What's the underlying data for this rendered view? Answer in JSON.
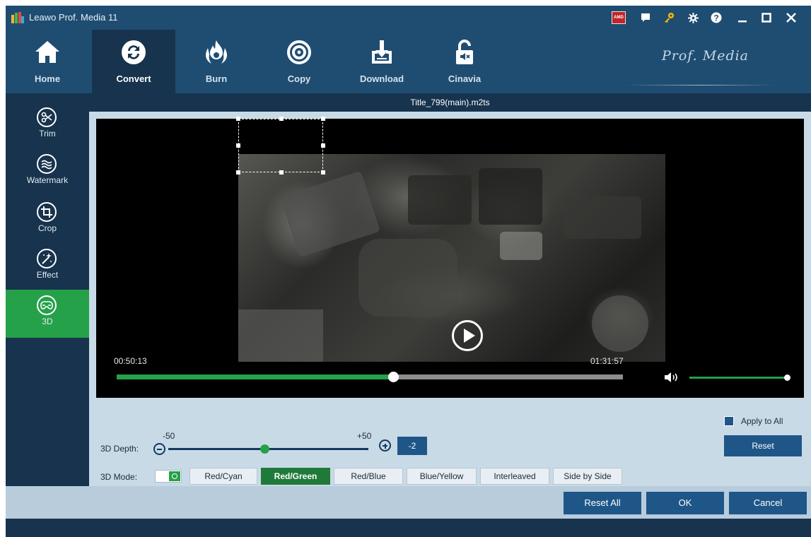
{
  "app": {
    "title": "Leawo Prof. Media 11",
    "brand": "Prof. Media"
  },
  "toolbar": {
    "items": [
      {
        "label": "Home",
        "icon": "home-icon",
        "active": false
      },
      {
        "label": "Convert",
        "icon": "convert-icon",
        "active": true
      },
      {
        "label": "Burn",
        "icon": "burn-icon",
        "active": false
      },
      {
        "label": "Copy",
        "icon": "copy-icon",
        "active": false
      },
      {
        "label": "Download",
        "icon": "download-icon",
        "active": false
      },
      {
        "label": "Cinavia",
        "icon": "cinavia-icon",
        "active": false
      }
    ]
  },
  "system_buttons": [
    "amd-icon",
    "chat-icon",
    "key-icon",
    "gear-icon",
    "help-icon",
    "minimize-icon",
    "maximize-icon",
    "close-icon"
  ],
  "sidebar": {
    "items": [
      {
        "label": "Trim",
        "icon": "trim-icon",
        "active": false
      },
      {
        "label": "Watermark",
        "icon": "watermark-icon",
        "active": false
      },
      {
        "label": "Crop",
        "icon": "crop-icon",
        "active": false
      },
      {
        "label": "Effect",
        "icon": "effect-icon",
        "active": false
      },
      {
        "label": "3D",
        "icon": "3d-glasses-icon",
        "active": true
      }
    ]
  },
  "player": {
    "filename": "Title_799(main).m2ts",
    "current_time": "00:50:13",
    "total_time": "01:31:57",
    "progress": 0.546,
    "volume": 0.985
  },
  "depth": {
    "label": "3D Depth:",
    "min_label": "-50",
    "max_label": "+50",
    "min": -50,
    "max": 50,
    "value": -2,
    "value_text": "-2"
  },
  "mode": {
    "label": "3D Mode:",
    "enabled": true,
    "options": [
      {
        "label": "Red/Cyan",
        "active": false
      },
      {
        "label": "Red/Green",
        "active": true
      },
      {
        "label": "Red/Blue",
        "active": false
      },
      {
        "label": "Blue/Yellow",
        "active": false
      },
      {
        "label": "Interleaved",
        "active": false
      },
      {
        "label": "Side by Side",
        "active": false
      }
    ]
  },
  "apply_all": {
    "label": "Apply to All",
    "checked": false
  },
  "reset_label": "Reset",
  "footer": {
    "reset_all": "Reset All",
    "ok": "OK",
    "cancel": "Cancel"
  },
  "colors": {
    "accent_green": "#25a14a",
    "primary_blue": "#1e5688",
    "dark_navy": "#17334d",
    "toolbar_blue": "#1f4d72"
  }
}
